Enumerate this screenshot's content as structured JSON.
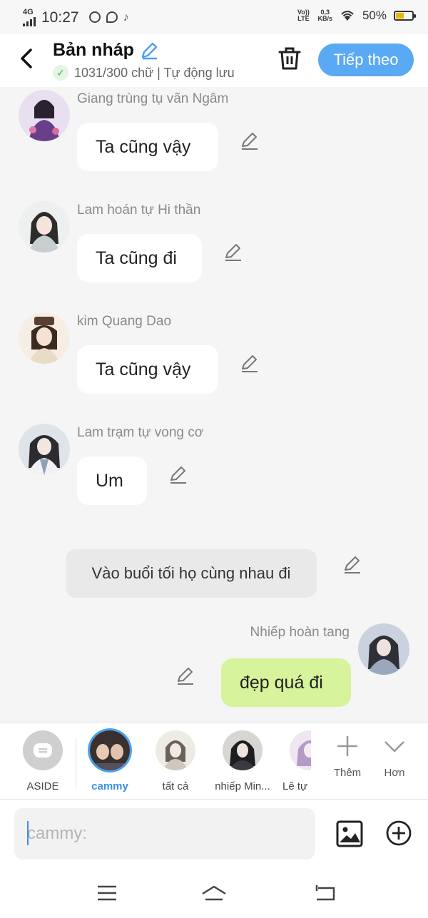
{
  "status_bar": {
    "network": "4G",
    "time": "10:27",
    "volte": "Vo)) LTE",
    "speed_value": "0,3",
    "speed_unit": "KB/s",
    "battery": "50%",
    "battery_level": 0.5
  },
  "header": {
    "title": "Bản nháp",
    "subtitle": "1031/300 chữ | Tự động lưu",
    "next_label": "Tiếp theo"
  },
  "messages": [
    {
      "name": "Giang trùng tụ vãn Ngâm",
      "text": "Ta cũng vậy"
    },
    {
      "name": "Lam hoán tự Hi thần",
      "text": "Ta cũng đi"
    },
    {
      "name": "kim Quang Dao",
      "text": "Ta cũng vậy"
    },
    {
      "name": "Lam trạm tự vong cơ",
      "text": "Um"
    }
  ],
  "aside_message": {
    "text": "Vào buổi tối họ cùng nhau đi"
  },
  "self_message": {
    "name": "Nhiếp hoàn tang",
    "text": "đẹp quá đi"
  },
  "characters": [
    {
      "label": "ASIDE"
    },
    {
      "label": "cammy"
    },
    {
      "label": "tất cả"
    },
    {
      "label": "nhiếp Min..."
    },
    {
      "label": "Lê tự"
    }
  ],
  "tools": {
    "add_label": "Thêm",
    "more_label": "Hơn"
  },
  "input": {
    "placeholder": "cammy:"
  },
  "colors": {
    "accent": "#5aa9f5",
    "self_bubble": "#d7f39b",
    "aside_bubble": "#e9e9e9",
    "background": "#f5f5f5"
  }
}
